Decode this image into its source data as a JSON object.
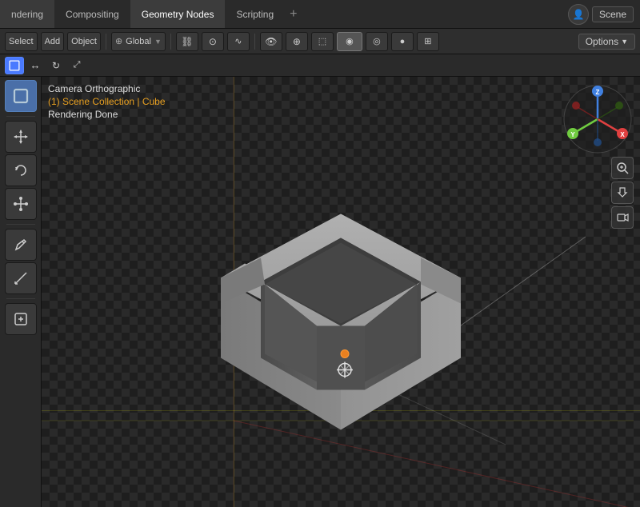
{
  "topMenu": {
    "tabs": [
      {
        "label": "ndering",
        "id": "rendering"
      },
      {
        "label": "Compositing",
        "id": "compositing"
      },
      {
        "label": "Geometry Nodes",
        "id": "geometry-nodes"
      },
      {
        "label": "Scripting",
        "id": "scripting"
      }
    ],
    "addTab": "+",
    "rightControls": {
      "userIcon": "👤",
      "sceneLabel": "Scene"
    }
  },
  "toolbar": {
    "select": "Select",
    "add": "Add",
    "object": "Object",
    "transform": "⊕ Global",
    "options": "Options"
  },
  "viewport": {
    "cameraLabel": "Camera Orthographic",
    "collectionLabel": "(1) Scene Collection | Cube",
    "statusLabel": "Rendering Done"
  },
  "leftTools": [
    {
      "icon": "⬚",
      "label": "select",
      "active": true
    },
    {
      "icon": "↔",
      "label": "move"
    },
    {
      "icon": "↻",
      "label": "rotate"
    },
    {
      "icon": "⤢",
      "label": "scale"
    },
    {
      "icon": "✎",
      "label": "annotate"
    },
    {
      "icon": "📐",
      "label": "measure"
    },
    {
      "icon": "⬡",
      "label": "add-object"
    }
  ],
  "rightTools": [
    {
      "icon": "🔍",
      "label": "zoom"
    },
    {
      "icon": "✋",
      "label": "pan"
    },
    {
      "icon": "🎥",
      "label": "camera"
    }
  ],
  "gizmo": {
    "xColor": "#e04040",
    "yColor": "#70cc40",
    "zColor": "#4080e0",
    "xNegColor": "#a02020",
    "yNegColor": "#306010",
    "zNegColor": "#205090"
  }
}
